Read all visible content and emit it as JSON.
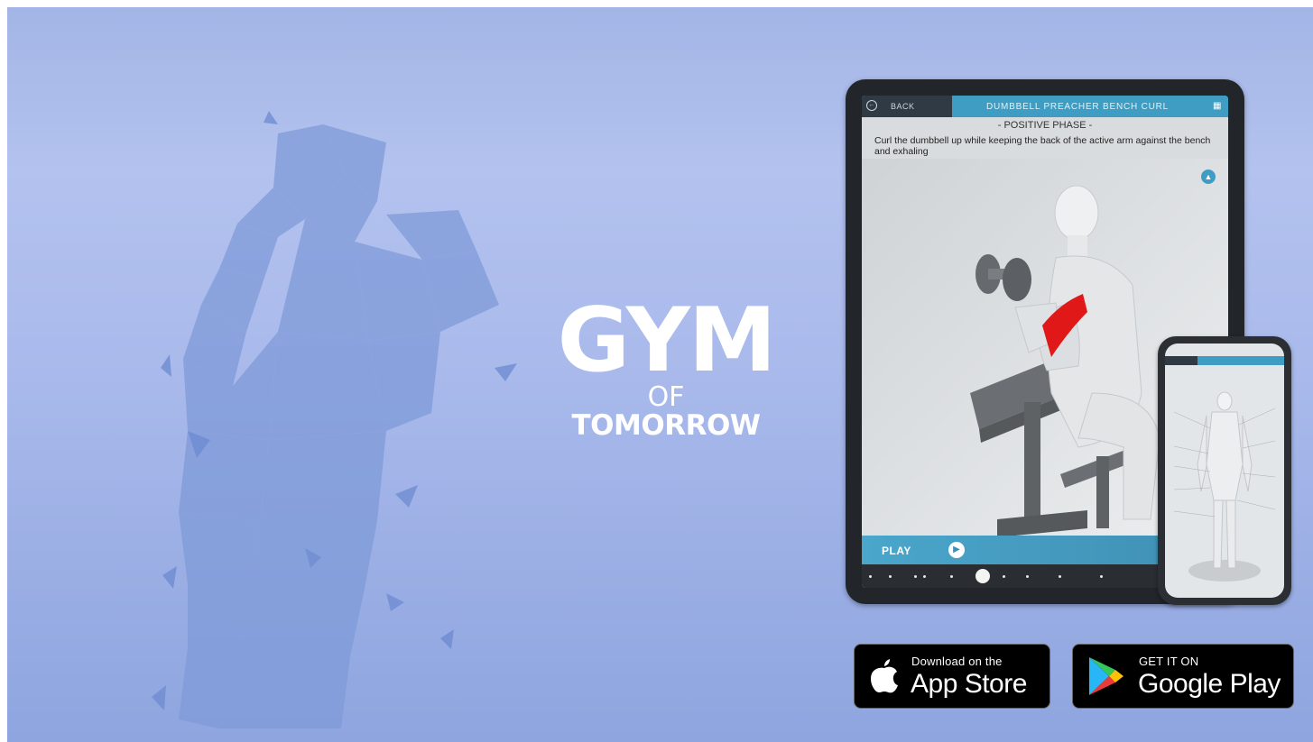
{
  "logo": {
    "line1": "GYM",
    "line2": "OF",
    "line3": "TOMORROW"
  },
  "tablet": {
    "back_label": "BACK",
    "exercise_title": "DUMBBELL PREACHER BENCH CURL",
    "phase_label": "- POSITIVE PHASE -",
    "description": "Curl the dumbbell up while keeping the back of the active arm against the bench and exhaling",
    "play_label": "PLAY"
  },
  "badges": {
    "apple_small": "Download on the",
    "apple_big": "App Store",
    "google_small": "GET IT ON",
    "google_big": "Google Play"
  },
  "icons": {
    "back": "back-circle-icon",
    "grid": "grid-icon",
    "collapse": "chevron-up-icon",
    "play": "play-icon",
    "apple": "apple-logo-icon",
    "google": "google-play-logo-icon"
  },
  "colors": {
    "background": "#a9b9eb",
    "accent": "#3f9cc2",
    "muscle_highlight": "#e01818"
  }
}
